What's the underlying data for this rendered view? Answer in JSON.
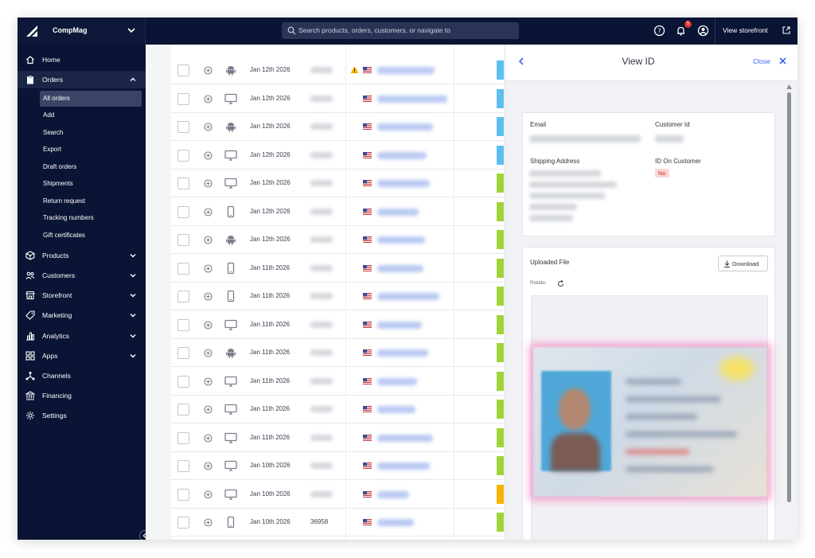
{
  "topbar": {
    "store_name": "CompMag",
    "search_placeholder": "Search products, orders, customers, or navigate to",
    "notification_count": "5",
    "view_storefront": "View storefront"
  },
  "sidebar": {
    "items": [
      {
        "label": "Home",
        "icon": "home-icon"
      },
      {
        "label": "Orders",
        "icon": "clipboard-icon"
      },
      {
        "label": "Products",
        "icon": "box-icon"
      },
      {
        "label": "Customers",
        "icon": "people-icon"
      },
      {
        "label": "Storefront",
        "icon": "store-icon"
      },
      {
        "label": "Marketing",
        "icon": "tag-icon"
      },
      {
        "label": "Analytics",
        "icon": "bar-chart-icon"
      },
      {
        "label": "Apps",
        "icon": "apps-icon"
      },
      {
        "label": "Channels",
        "icon": "channels-icon"
      },
      {
        "label": "Financing",
        "icon": "bank-icon"
      },
      {
        "label": "Settings",
        "icon": "gear-icon"
      }
    ],
    "orders_subitems": [
      "All orders",
      "Add",
      "Search",
      "Export",
      "Draft orders",
      "Shipments",
      "Return request",
      "Tracking numbers",
      "Gift certificates"
    ]
  },
  "orders": {
    "rows": [
      {
        "device": "android",
        "date": "Jan 12th 2026",
        "order_number": "",
        "warning": true,
        "status_color": "#5bc0f0"
      },
      {
        "device": "desktop",
        "date": "Jan 12th 2026",
        "order_number": "",
        "warning": false,
        "status_color": "#5bc0f0"
      },
      {
        "device": "android",
        "date": "Jan 12th 2026",
        "order_number": "",
        "warning": false,
        "status_color": "#5bc0f0"
      },
      {
        "device": "desktop",
        "date": "Jan 12th 2026",
        "order_number": "",
        "warning": false,
        "status_color": "#5bc0f0"
      },
      {
        "device": "desktop",
        "date": "Jan 12th 2026",
        "order_number": "",
        "warning": false,
        "status_color": "#a0d33a"
      },
      {
        "device": "mobile",
        "date": "Jan 12th 2026",
        "order_number": "",
        "warning": false,
        "status_color": "#a0d33a"
      },
      {
        "device": "android",
        "date": "Jan 12th 2026",
        "order_number": "",
        "warning": false,
        "status_color": "#a0d33a"
      },
      {
        "device": "mobile",
        "date": "Jan 11th 2026",
        "order_number": "",
        "warning": false,
        "status_color": "#a0d33a"
      },
      {
        "device": "mobile",
        "date": "Jan 11th 2026",
        "order_number": "",
        "warning": false,
        "status_color": "#a0d33a"
      },
      {
        "device": "desktop",
        "date": "Jan 11th 2026",
        "order_number": "",
        "warning": false,
        "status_color": "#a0d33a"
      },
      {
        "device": "android",
        "date": "Jan 11th 2026",
        "order_number": "",
        "warning": false,
        "status_color": "#a0d33a"
      },
      {
        "device": "desktop",
        "date": "Jan 11th 2026",
        "order_number": "",
        "warning": false,
        "status_color": "#a0d33a"
      },
      {
        "device": "desktop",
        "date": "Jan 11th 2026",
        "order_number": "",
        "warning": false,
        "status_color": "#a0d33a"
      },
      {
        "device": "desktop",
        "date": "Jan 11th 2026",
        "order_number": "",
        "warning": false,
        "status_color": "#a0d33a"
      },
      {
        "device": "desktop",
        "date": "Jan 10th 2026",
        "order_number": "",
        "warning": false,
        "status_color": "#a0d33a"
      },
      {
        "device": "desktop",
        "date": "Jan 10th 2026",
        "order_number": "",
        "warning": false,
        "status_color": "#f5b400"
      },
      {
        "device": "mobile",
        "date": "Jan 10th 2026",
        "order_number": "36958",
        "warning": false,
        "status_color": "#a0d33a"
      }
    ]
  },
  "panel": {
    "title": "View ID",
    "close_label": "Close",
    "email_label": "Email",
    "customer_id_label": "Customer Id",
    "shipping_address_label": "Shipping Address",
    "id_on_customer_label": "ID On Customer",
    "id_on_customer_value": "No",
    "uploaded_file_label": "Uploaded File",
    "download_label": "Download",
    "rotate_label": "Rotate:"
  },
  "colors": {
    "nav_bg": "#0a1434",
    "accent": "#3c64f4",
    "highlight": "#f47cbe"
  }
}
